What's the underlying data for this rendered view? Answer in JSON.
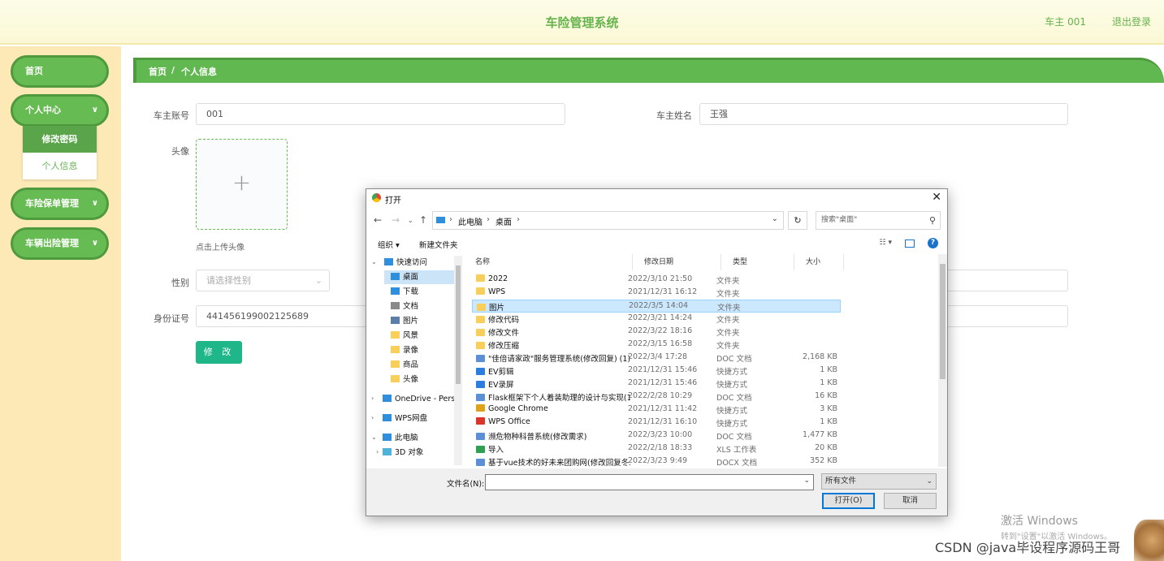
{
  "header": {
    "title": "车险管理系统",
    "user": "车主 001",
    "logout": "退出登录"
  },
  "sidebar": {
    "home": "首页",
    "personal_center": "个人中心",
    "submenu": [
      "修改密码",
      "个人信息"
    ],
    "policy_mgmt": "车险保单管理",
    "claims_mgmt": "车辆出险管理"
  },
  "breadcrumb": {
    "home": "首页",
    "sep": "/",
    "current": "个人信息"
  },
  "form": {
    "account_label": "车主账号",
    "account_value": "001",
    "name_label": "车主姓名",
    "name_value": "王强",
    "avatar_label": "头像",
    "upload_tip": "点击上传头像",
    "gender_label": "性别",
    "gender_placeholder": "请选择性别",
    "id_label": "身份证号",
    "id_value": "441456199002125689",
    "submit": "修 改"
  },
  "dialog": {
    "title": "打开",
    "path": [
      "此电脑",
      "桌面"
    ],
    "search_placeholder": "搜索\"桌面\"",
    "toolbar": {
      "organize": "组织 ▾",
      "new_folder": "新建文件夹"
    },
    "tree": [
      {
        "label": "快速访问",
        "type": "star"
      },
      {
        "label": "桌面",
        "type": "desktop",
        "selected": true
      },
      {
        "label": "下载",
        "type": "download"
      },
      {
        "label": "文档",
        "type": "doc"
      },
      {
        "label": "图片",
        "type": "pic"
      },
      {
        "label": "风景",
        "type": "folder"
      },
      {
        "label": "录像",
        "type": "folder"
      },
      {
        "label": "商品",
        "type": "folder"
      },
      {
        "label": "头像",
        "type": "folder"
      },
      {
        "label": "OneDrive - Perso",
        "type": "cloud"
      },
      {
        "label": "WPS网盘",
        "type": "cloud"
      },
      {
        "label": "此电脑",
        "type": "pc"
      },
      {
        "label": "3D 对象",
        "type": "3d"
      }
    ],
    "columns": {
      "name": "名称",
      "date": "修改日期",
      "type": "类型",
      "size": "大小"
    },
    "files": [
      {
        "name": "2022",
        "date": "2022/3/10 21:50",
        "type": "文件夹",
        "size": "",
        "icon": "folder"
      },
      {
        "name": "WPS",
        "date": "2021/12/31 16:12",
        "type": "文件夹",
        "size": "",
        "icon": "folder"
      },
      {
        "name": "图片",
        "date": "2022/3/5 14:04",
        "type": "文件夹",
        "size": "",
        "icon": "folder",
        "selected": true
      },
      {
        "name": "修改代码",
        "date": "2022/3/21 14:24",
        "type": "文件夹",
        "size": "",
        "icon": "folder"
      },
      {
        "name": "修改文件",
        "date": "2022/3/22 18:16",
        "type": "文件夹",
        "size": "",
        "icon": "folder"
      },
      {
        "name": "修改压缩",
        "date": "2022/3/15 16:58",
        "type": "文件夹",
        "size": "",
        "icon": "folder"
      },
      {
        "name": "\"佳倍请家政\"服务管理系统(修改回复) (1)",
        "date": "2022/3/4 17:28",
        "type": "DOC 文档",
        "size": "2,168 KB",
        "icon": "doc"
      },
      {
        "name": "EV剪辑",
        "date": "2021/12/31 15:46",
        "type": "快捷方式",
        "size": "1 KB",
        "icon": "ev"
      },
      {
        "name": "EV录屏",
        "date": "2021/12/31 15:46",
        "type": "快捷方式",
        "size": "1 KB",
        "icon": "ev"
      },
      {
        "name": "Flask框架下个人着装助理的设计与实现(1)",
        "date": "2022/2/28 10:29",
        "type": "DOC 文档",
        "size": "16 KB",
        "icon": "doc"
      },
      {
        "name": "Google Chrome",
        "date": "2021/12/31 11:42",
        "type": "快捷方式",
        "size": "3 KB",
        "icon": "chrome"
      },
      {
        "name": "WPS Office",
        "date": "2021/12/31 16:10",
        "type": "快捷方式",
        "size": "1 KB",
        "icon": "wps"
      },
      {
        "name": "濒危物种科普系统(修改需求)",
        "date": "2022/3/23 10:00",
        "type": "DOC 文档",
        "size": "1,477 KB",
        "icon": "doc"
      },
      {
        "name": "导入",
        "date": "2022/2/18 18:33",
        "type": "XLS 工作表",
        "size": "20 KB",
        "icon": "xls"
      },
      {
        "name": "基于vue技术的好未来团购网(修改回复冬...",
        "date": "2022/3/23 9:49",
        "type": "DOCX 文档",
        "size": "352 KB",
        "icon": "doc"
      }
    ],
    "filename_label": "文件名(N):",
    "filetype": "所有文件",
    "open": "打开(O)",
    "cancel": "取消"
  },
  "watermark": {
    "activate": "激活 Windows",
    "activate_sub": "转到\"设置\"以激活 Windows。",
    "csdn": "CSDN @java毕设程序源码王哥"
  },
  "colors": {
    "accent": "#62b850",
    "submit": "#1fb689",
    "sidebar": "#fde9b6"
  }
}
